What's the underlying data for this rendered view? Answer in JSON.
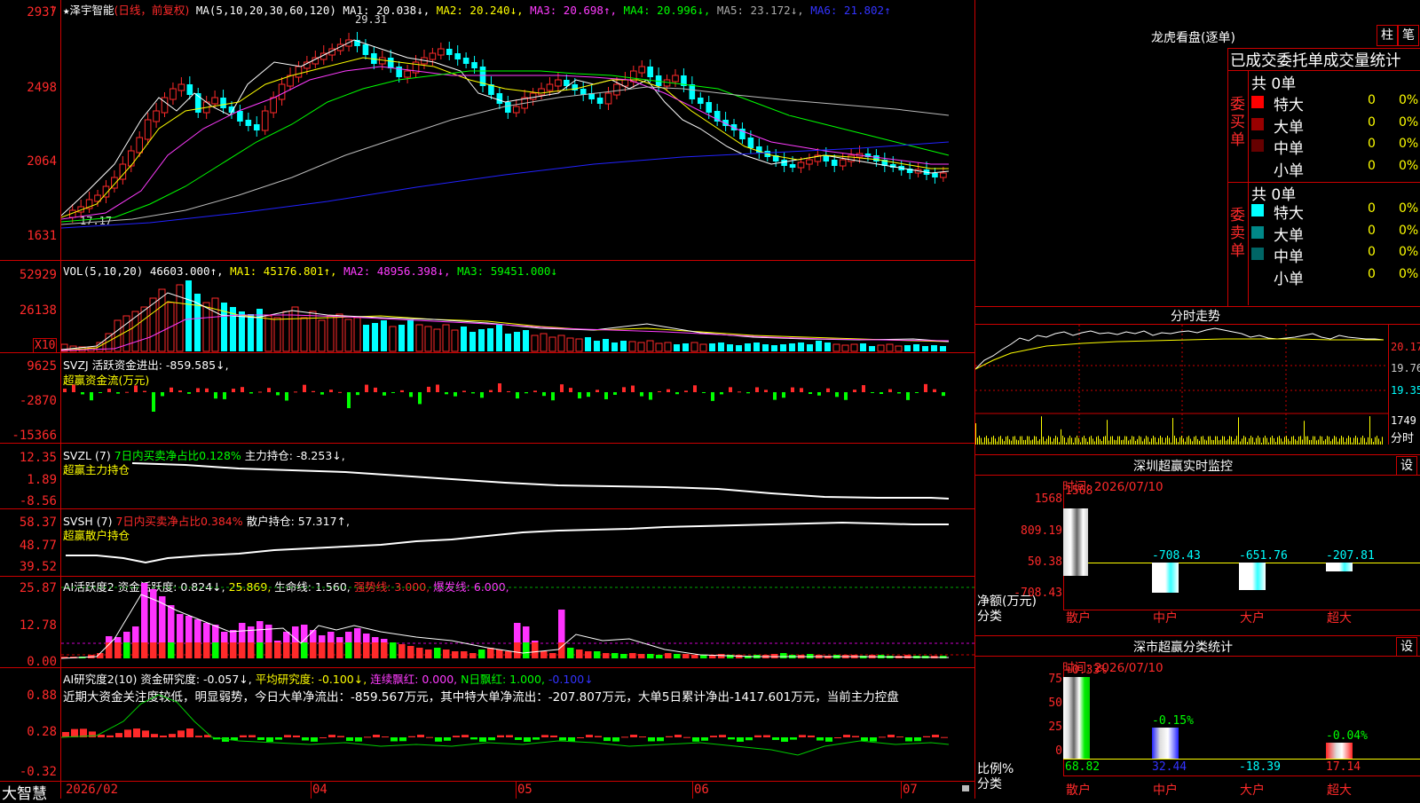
{
  "stock": {
    "star": "★",
    "name": "泽宇智能",
    "period": "(日线，前复权)",
    "ma_label": "MA(5,10,20,30,60,120)",
    "ma1": "MA1: 20.038↓,",
    "ma2": "MA2: 20.240↓,",
    "ma3": "MA3: 20.698↑,",
    "ma4": "MA4: 20.996↓,",
    "ma5": "MA5: 23.172↓,",
    "ma6": "MA6: 21.802↑",
    "high_mark": "29.31",
    "low_mark": "17.17"
  },
  "axes": {
    "price": [
      "2937",
      "2498",
      "2064",
      "1631"
    ],
    "vol": [
      "52929",
      "26138",
      "X10"
    ],
    "svzj": [
      "9625",
      "-2870",
      "-15366"
    ],
    "svzl": [
      "12.35",
      "1.89",
      "-8.56"
    ],
    "svsh": [
      "58.37",
      "48.77",
      "39.52"
    ],
    "ai1": [
      "25.87",
      "12.78",
      "0.00"
    ],
    "ai2": [
      "0.88",
      "0.28",
      "-0.32"
    ]
  },
  "vol": {
    "label": "VOL(5,10,20)",
    "v": "46603.000↑,",
    "ma1": "MA1: 45176.801↑,",
    "ma2": "MA2: 48956.398↓,",
    "ma3": "MA3: 59451.000↓"
  },
  "svzj": {
    "code": "SVZJ",
    "label": "活跃资金进出: -859.585↓,",
    "sub": "超赢资金流(万元)"
  },
  "svzl": {
    "code": "SVZL (7)",
    "ratio": "7日内买卖净占比0.128%",
    "label": "主力持仓: -8.253↓,",
    "sub": "超赢主力持仓"
  },
  "svsh": {
    "code": "SVSH (7)",
    "ratio": "7日内买卖净占比0.384%",
    "label": "散户持仓: 57.317↑,",
    "sub": "超赢散户持仓"
  },
  "ai1": {
    "code": "AI活跃度2",
    "a": "资金活跃度: 0.824↓,",
    "b": "25.869,",
    "c": "生命线: 1.560,",
    "d": "强势线: 3.000,",
    "e": "爆发线: 6.000,"
  },
  "ai2": {
    "code": "AI研究度2(10)",
    "a": "资金研究度: -0.057↓,",
    "b": "平均研究度: -0.100↓,",
    "c": "连续飘红: 0.000,",
    "d": "N日飘红: 1.000,",
    "e": "-0.100↓",
    "text": "近期大资金关注度较低，明显弱势，今日大单净流出：-859.567万元，其中特大单净流出：-207.807万元，大单5日累计净出-1417.601万元，当前主力控盘"
  },
  "bottom": {
    "brand": "大智慧",
    "dates": [
      "2026/02",
      "04",
      "05",
      "06",
      "07"
    ]
  },
  "dragon": {
    "title": "龙虎看盘(逐单)",
    "btn1": "柱",
    "btn2": "笔",
    "header": "已成交委托单成交量统计",
    "buy_label": "委买单",
    "sell_label": "委卖单",
    "buy_total": "共 0单",
    "sell_total": "共 0单",
    "buy_rows": [
      {
        "label": "特大",
        "count": "0",
        "pct": "0%",
        "color": "#ff0000"
      },
      {
        "label": "大单",
        "count": "0",
        "pct": "0%",
        "color": "#990000"
      },
      {
        "label": "中单",
        "count": "0",
        "pct": "0%",
        "color": "#660000"
      },
      {
        "label": "小单",
        "count": "0",
        "pct": "0%",
        "color": ""
      }
    ],
    "sell_rows": [
      {
        "label": "特大",
        "count": "0",
        "pct": "0%",
        "color": "#00ffff"
      },
      {
        "label": "大单",
        "count": "0",
        "pct": "0%",
        "color": "#008888"
      },
      {
        "label": "中单",
        "count": "0",
        "pct": "0%",
        "color": "#006666"
      },
      {
        "label": "小单",
        "count": "0",
        "pct": "0%",
        "color": ""
      }
    ]
  },
  "intraday": {
    "title": "分时走势",
    "p1": "20.17",
    "p2": "19.76",
    "p3": "19.35",
    "vol": "1749",
    "vlabel": "分时"
  },
  "monitor": {
    "title": "深圳超赢实时监控",
    "btn": "设",
    "time": "时间: 2026/07/10",
    "yaxis": [
      "1568",
      "809.19",
      "50.38",
      "-708.43"
    ],
    "ylabel": "净额(万元)",
    "xlabel": "分类",
    "cats": [
      "散户",
      "中户",
      "大户",
      "超大"
    ],
    "values": [
      "1568",
      "-708.43",
      "-651.76",
      "-207.81"
    ]
  },
  "classify": {
    "title": "深市超赢分类统计",
    "btn": "设",
    "time": "时间: 2026/07/10",
    "yaxis": [
      "75",
      "50",
      "25",
      "0"
    ],
    "ylabel": "比例%",
    "xlabel": "分类",
    "cats": [
      "散户",
      "中户",
      "大户",
      "超大"
    ],
    "pcts": [
      "+0.33%",
      "-0.15%",
      "",
      "-0.04%"
    ],
    "values": [
      "68.82",
      "32.44",
      "-18.39",
      "17.14"
    ]
  }
}
